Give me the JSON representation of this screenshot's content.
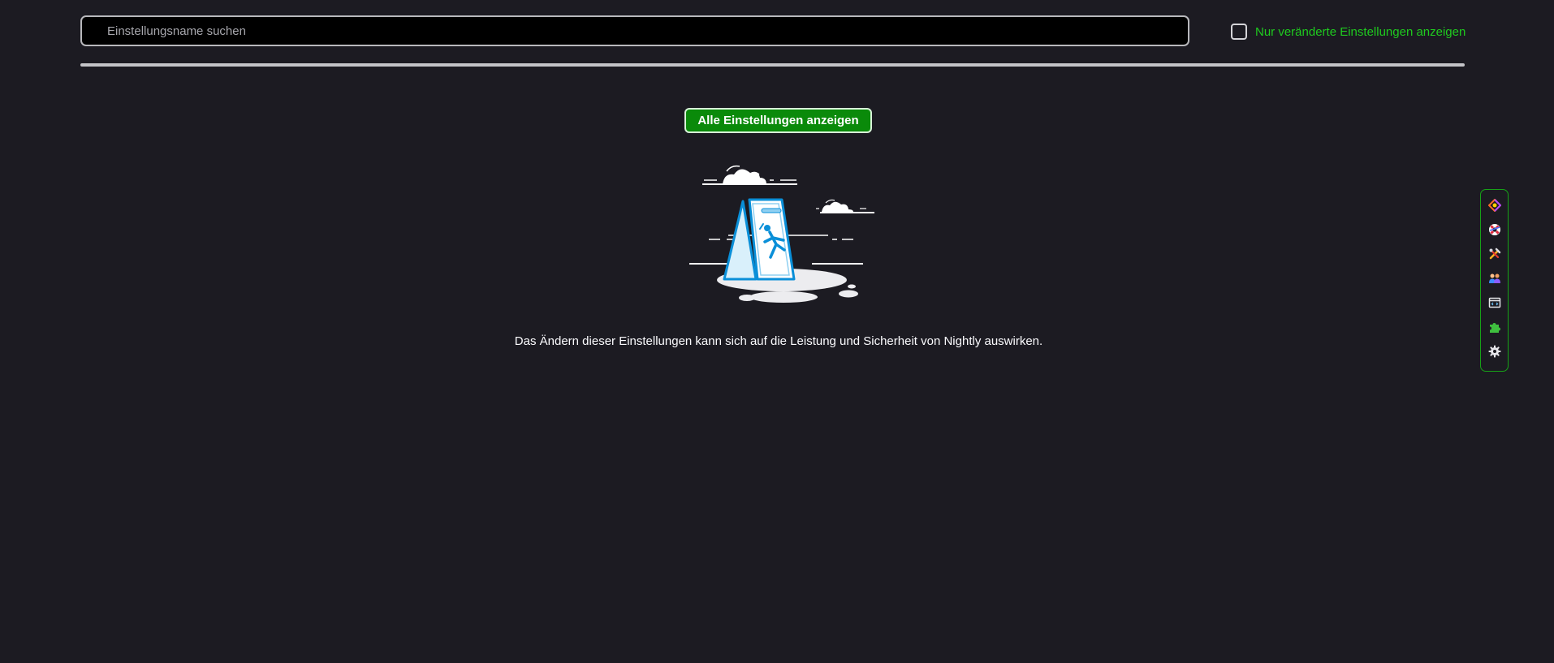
{
  "search": {
    "placeholder": "Einstellungsname suchen",
    "value": ""
  },
  "filter": {
    "label": "Nur veränderte Einstellungen anzeigen",
    "checked": false,
    "color": "#1fcb1f"
  },
  "main": {
    "show_all_label": "Alle Einstellungen anzeigen",
    "warning_text": "Das Ändern dieser Einstellungen kann sich auf die Leistung und Sicherheit von Nightly auswirken.",
    "illustration": "wet-floor-warning-illustration"
  },
  "sidebar": {
    "items": [
      {
        "icon": "extension-colorful-icon"
      },
      {
        "icon": "lifebuoy-icon"
      },
      {
        "icon": "tools-icon"
      },
      {
        "icon": "users-icon"
      },
      {
        "icon": "window-code-icon"
      },
      {
        "icon": "puzzle-icon"
      },
      {
        "icon": "gear-icon"
      }
    ]
  },
  "colors": {
    "background": "#1c1b22",
    "accent": "#0a8a0a",
    "toolbar_border": "#17a117"
  }
}
